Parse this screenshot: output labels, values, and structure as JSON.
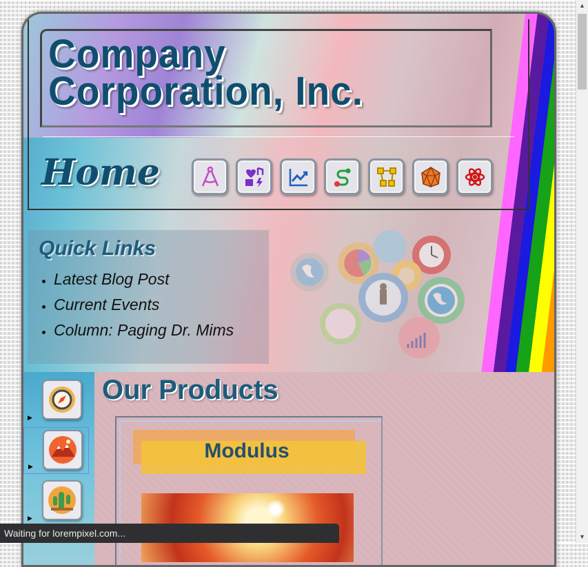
{
  "header": {
    "site_title": "Company Corporation, Inc.",
    "page_title": "Home"
  },
  "nav": {
    "icons": [
      "drafting-compass-icon",
      "shapes-music-icon",
      "line-chart-icon",
      "route-icon",
      "vector-nodes-icon",
      "polyhedron-icon",
      "atom-icon"
    ]
  },
  "quick_links": {
    "heading": "Quick Links",
    "items": [
      "Latest Blog Post",
      "Current Events",
      "Column: Paging Dr. Mims"
    ]
  },
  "products": {
    "heading": "Our Products",
    "current": "Modulus",
    "sidebar_icons": [
      "compass-icon",
      "mountain-icon",
      "cactus-icon"
    ]
  },
  "status_bar": {
    "text": "Waiting for lorempixel.com..."
  },
  "colors": {
    "title": "#0f4e6e",
    "heading": "#1d5c7c",
    "label_bg": "#f3c23d"
  }
}
